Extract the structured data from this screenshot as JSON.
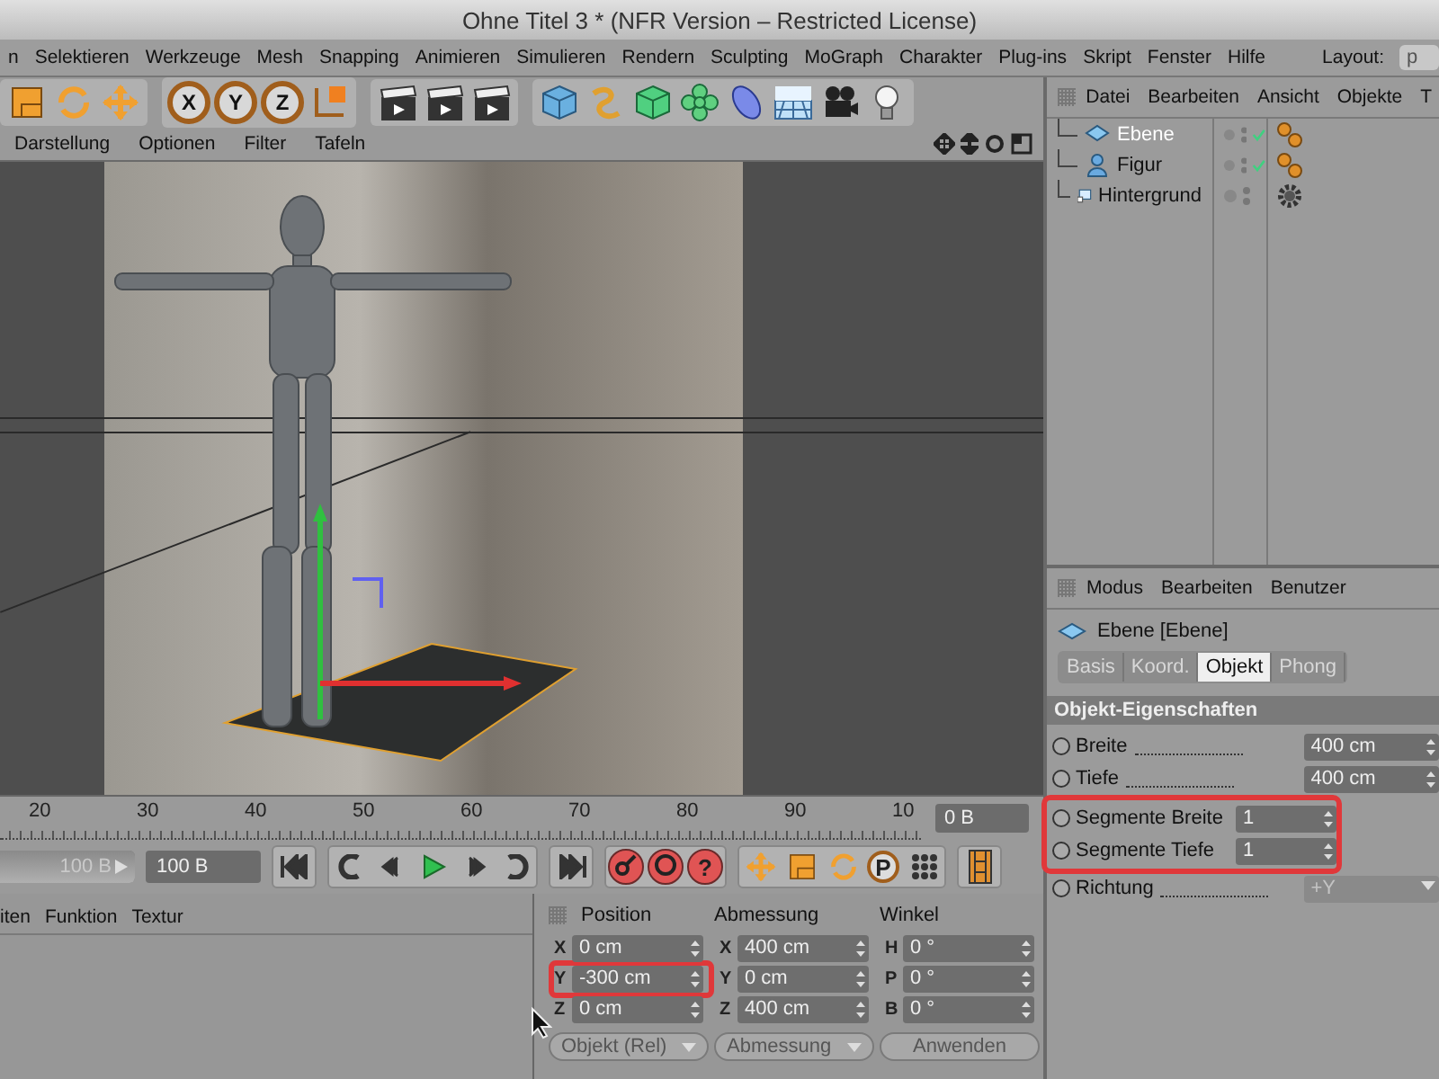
{
  "window": {
    "title": "Ohne Titel 3 * (NFR Version – Restricted License)"
  },
  "menu_bar": {
    "items": [
      "n",
      "Selektieren",
      "Werkzeuge",
      "Mesh",
      "Snapping",
      "Animieren",
      "Simulieren",
      "Rendern",
      "Sculpting",
      "MoGraph",
      "Charakter",
      "Plug-ins",
      "Skript",
      "Fenster",
      "Hilfe"
    ],
    "layout_label": "Layout:",
    "layout_value": "p"
  },
  "toolbar": {
    "axis_buttons": [
      "X",
      "Y",
      "Z"
    ]
  },
  "viewport": {
    "menu": [
      "Darstellung",
      "Optionen",
      "Filter",
      "Tafeln"
    ]
  },
  "object_manager": {
    "menu": [
      "Datei",
      "Bearbeiten",
      "Ansicht",
      "Objekte",
      "T"
    ],
    "objects": [
      {
        "name": "Ebene",
        "selected": true,
        "checked": true,
        "kind": "spheres"
      },
      {
        "name": "Figur",
        "selected": false,
        "checked": true,
        "kind": "spheres"
      },
      {
        "name": "Hintergrund",
        "selected": false,
        "checked": false,
        "kind": "gear"
      }
    ]
  },
  "attributes": {
    "menu": [
      "Modus",
      "Bearbeiten",
      "Benutzer"
    ],
    "object_title": "Ebene [Ebene]",
    "tabs": [
      {
        "label": "Basis",
        "selected": false
      },
      {
        "label": "Koord.",
        "selected": false
      },
      {
        "label": "Objekt",
        "selected": true
      },
      {
        "label": "Phong",
        "selected": false
      }
    ],
    "section": "Objekt-Eigenschaften",
    "fields": [
      {
        "label": "Breite",
        "value": "400 cm",
        "kind": "number",
        "leader": true,
        "highlighted": false,
        "disabled": false,
        "checked": false
      },
      {
        "label": "Tiefe",
        "value": "400 cm",
        "kind": "number",
        "leader": true,
        "highlighted": false,
        "disabled": false,
        "checked": false
      },
      {
        "label": "Segmente Breite",
        "value": "1",
        "kind": "number",
        "leader": false,
        "highlighted": true,
        "disabled": false,
        "checked": false
      },
      {
        "label": "Segmente Tiefe",
        "value": "1",
        "kind": "number",
        "leader": false,
        "highlighted": true,
        "disabled": false,
        "checked": false
      },
      {
        "label": "Richtung",
        "value": "+Y",
        "kind": "dropdown",
        "leader": true,
        "highlighted": false,
        "disabled": true,
        "checked": false
      }
    ]
  },
  "timeline": {
    "ticks": [
      "20",
      "30",
      "40",
      "50",
      "60",
      "70",
      "80",
      "90",
      "10"
    ],
    "end_field": "0 B"
  },
  "playback": {
    "slider": {
      "value": "100 B",
      "level": 1
    },
    "frame_field": "100 B",
    "help_key": "?",
    "point_key": "P"
  },
  "material_manager": {
    "menu": [
      "iten",
      "Funktion",
      "Textur"
    ]
  },
  "coordinates": {
    "columns": [
      {
        "header": "Position",
        "fields": [
          {
            "axis": "X",
            "value": "0 cm",
            "highlighted": false
          },
          {
            "axis": "Y",
            "value": "-300 cm",
            "highlighted": true
          },
          {
            "axis": "Z",
            "value": "0 cm",
            "highlighted": false
          }
        ],
        "control": {
          "kind": "dropdown",
          "label": "Objekt (Rel)"
        }
      },
      {
        "header": "Abmessung",
        "fields": [
          {
            "axis": "X",
            "value": "400 cm",
            "highlighted": false
          },
          {
            "axis": "Y",
            "value": "0 cm",
            "highlighted": false
          },
          {
            "axis": "Z",
            "value": "400 cm",
            "highlighted": false
          }
        ],
        "control": {
          "kind": "dropdown",
          "label": "Abmessung"
        }
      },
      {
        "header": "Winkel",
        "fields": [
          {
            "axis": "H",
            "value": "0 °",
            "highlighted": false
          },
          {
            "axis": "P",
            "value": "0 °",
            "highlighted": false
          },
          {
            "axis": "B",
            "value": "0 °",
            "highlighted": false
          }
        ],
        "control": {
          "kind": "button",
          "label": "Anwenden"
        }
      }
    ]
  }
}
